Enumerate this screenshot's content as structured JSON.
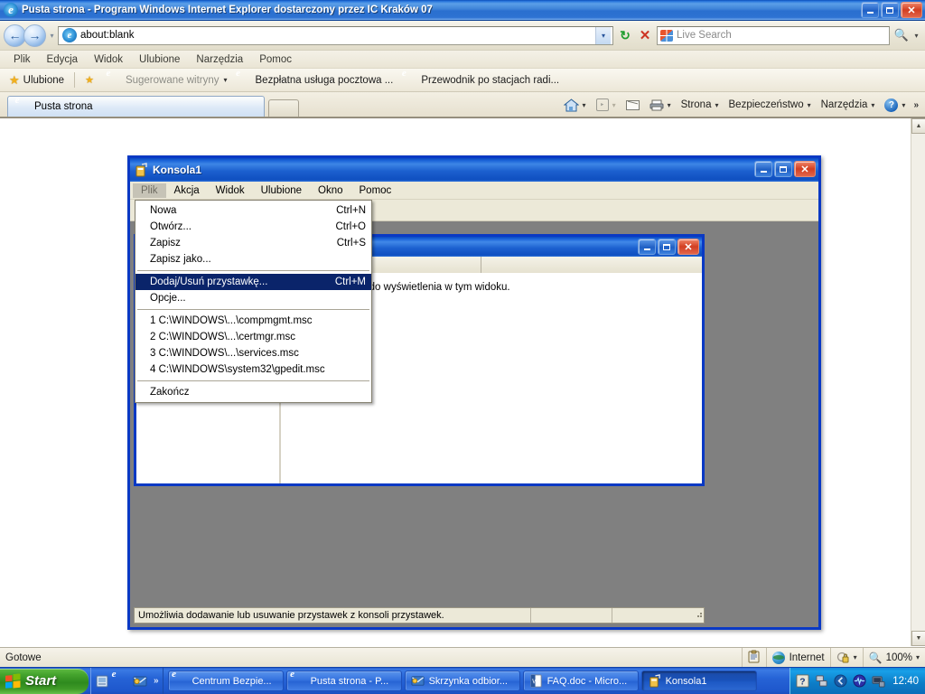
{
  "browser": {
    "window_title": "Pusta strona - Program Windows Internet Explorer dostarczony przez IC Kraków 07",
    "title_icon": "ie-logo-icon",
    "caption": {
      "minimize": "–",
      "maximize": "❐",
      "close": "✕"
    },
    "address": {
      "icon": "ie-logo-icon",
      "value": "about:blank",
      "dropdown_caret": "▾",
      "refresh_label": "↻",
      "stop_label": "✕"
    },
    "search": {
      "provider_icon": "windows-flag-icon",
      "placeholder": "Live Search",
      "value": "",
      "go_icon": "magnifier-icon",
      "go_caret": "▾"
    },
    "menubar": [
      "Plik",
      "Edycja",
      "Widok",
      "Ulubione",
      "Narzędzia",
      "Pomoc"
    ],
    "favbar": {
      "favorites_label": "Ulubione",
      "add_icon": "add-favorite-icon",
      "items": [
        {
          "label": "Sugerowane witryny",
          "icon": "ie-logo-icon",
          "caret": "▾",
          "dim": true
        },
        {
          "label": "Bezpłatna usługa pocztowa ...",
          "icon": "ie-logo-icon",
          "dim": false
        },
        {
          "label": "Przewodnik po stacjach radi...",
          "icon": "ie-logo-icon",
          "dim": false
        }
      ]
    },
    "tabs": [
      {
        "label": "Pusta strona",
        "icon": "ie-logo-icon",
        "active": true
      }
    ],
    "new_tab_label": "",
    "commandbar": [
      {
        "label": "",
        "icon": "home-icon",
        "caret": "▾"
      },
      {
        "label": "",
        "icon": "rss-icon",
        "caret": "▾",
        "dim": true
      },
      {
        "label": "",
        "icon": "mail-icon",
        "caret": ""
      },
      {
        "label": "",
        "icon": "print-icon",
        "caret": "▾"
      },
      {
        "label": "Strona",
        "icon": "",
        "caret": "▾"
      },
      {
        "label": "Bezpieczeństwo",
        "icon": "",
        "caret": "▾"
      },
      {
        "label": "Narzędzia",
        "icon": "",
        "caret": "▾"
      },
      {
        "label": "",
        "icon": "help-icon",
        "caret": "▾"
      }
    ],
    "commandbar_overflow": "»",
    "scrollbar": {
      "up": "▲",
      "down": "▼"
    },
    "statusbar": {
      "message": "Gotowe",
      "zone_icon": "zone-icon",
      "zone_globe_icon": "globe-icon",
      "zone_label": "Internet",
      "privacy_icon": "privacy-lock-icon",
      "privacy_caret": "▾",
      "zoom_icon": "magnifier-icon",
      "zoom_label": "100%",
      "zoom_caret": "▾"
    }
  },
  "mmc": {
    "title": "Konsola1",
    "title_icon": "mmc-console-icon",
    "caption": {
      "minimize": "–",
      "maximize": "❐",
      "close": "✕"
    },
    "menubar": [
      {
        "label": "Plik",
        "active": true
      },
      {
        "label": "Akcja",
        "active": false
      },
      {
        "label": "Widok",
        "active": false
      },
      {
        "label": "Ulubione",
        "active": false
      },
      {
        "label": "Okno",
        "active": false
      },
      {
        "label": "Pomoc",
        "active": false
      }
    ],
    "file_menu": {
      "items": [
        {
          "label": "Nowa",
          "accel": "Ctrl+N",
          "selected": false,
          "divider_after": false
        },
        {
          "label": "Otwórz...",
          "accel": "Ctrl+O",
          "selected": false,
          "divider_after": false
        },
        {
          "label": "Zapisz",
          "accel": "Ctrl+S",
          "selected": false,
          "divider_after": false
        },
        {
          "label": "Zapisz jako...",
          "accel": "",
          "selected": false,
          "divider_after": true
        },
        {
          "label": "Dodaj/Usuń przystawkę...",
          "accel": "Ctrl+M",
          "selected": true,
          "divider_after": false
        },
        {
          "label": "Opcje...",
          "accel": "",
          "selected": false,
          "divider_after": true
        },
        {
          "label": "1 C:\\WINDOWS\\...\\compmgmt.msc",
          "accel": "",
          "selected": false,
          "divider_after": false
        },
        {
          "label": "2 C:\\WINDOWS\\...\\certmgr.msc",
          "accel": "",
          "selected": false,
          "divider_after": false
        },
        {
          "label": "3 C:\\WINDOWS\\...\\services.msc",
          "accel": "",
          "selected": false,
          "divider_after": false
        },
        {
          "label": "4 C:\\WINDOWS\\system32\\gpedit.msc",
          "accel": "",
          "selected": false,
          "divider_after": true
        },
        {
          "label": "Zakończ",
          "accel": "",
          "selected": false,
          "divider_after": false
        }
      ]
    },
    "child_window": {
      "title": "",
      "caption": {
        "minimize": "–",
        "maximize": "❐",
        "close": "✕"
      },
      "columns": [
        "",
        ""
      ],
      "empty_message": "Brak elementów do wyświetlenia w tym widoku."
    },
    "statusbar": {
      "message": "Umożliwia dodawanie lub usuwanie przystawek z konsoli przystawek.",
      "cells": [
        "",
        ""
      ]
    }
  },
  "taskbar": {
    "start_label": "Start",
    "start_icon": "windows-flag-icon",
    "quicklaunch": [
      {
        "icon": "show-desktop-icon"
      },
      {
        "icon": "ie-logo-icon"
      },
      {
        "icon": "outlook-icon"
      }
    ],
    "quicklaunch_overflow": "»",
    "tasks": [
      {
        "label": "Centrum Bezpie...",
        "icon": "ie-logo-icon",
        "active": false
      },
      {
        "label": "Pusta strona - P...",
        "icon": "ie-logo-icon",
        "active": false
      },
      {
        "label": "Skrzynka odbior...",
        "icon": "outlook-icon",
        "active": false
      },
      {
        "label": "FAQ.doc - Micro...",
        "icon": "word-icon",
        "active": false
      },
      {
        "label": "Konsola1",
        "icon": "mmc-console-icon",
        "active": true
      }
    ],
    "tray": [
      {
        "icon": "help-question-icon"
      },
      {
        "icon": "network-icon"
      },
      {
        "icon": "shield-icon"
      },
      {
        "icon": "audio-icon"
      },
      {
        "icon": "display-icon"
      }
    ],
    "clock": "12:40"
  },
  "colors": {
    "xp_blue": "#0a4ac0",
    "xp_title_gradient_light": "#4189e8",
    "menu_highlight": "#0a246a",
    "taskbar_blue": "#2663d6",
    "start_green": "#2e8a1e",
    "face": "#ece9d8",
    "desktop_gray": "#808080",
    "mmc_border": "#0a39c4"
  }
}
